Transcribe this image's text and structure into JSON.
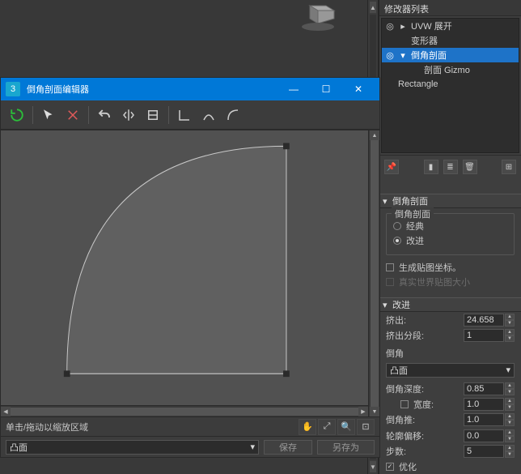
{
  "right": {
    "header": "修改器列表",
    "mods": {
      "uvw": "UVW 展开",
      "deform": "变形器",
      "bevel": "倒角剖面",
      "gizmo": "剖面 Gizmo",
      "rect": "Rectangle"
    },
    "rollout_bevel": "倒角剖面",
    "radio_classic": "经典",
    "radio_advance": "改进",
    "chk_gen_uvs": "生成贴图坐标。",
    "chk_realworld": "真实世界贴图大小",
    "rollout_advance": "改进",
    "extrude": {
      "label": "挤出:",
      "value": "24.658"
    },
    "extrude_segs": {
      "label": "挤出分段:",
      "value": "1"
    },
    "bevel_group": "倒角",
    "bevel_type": "凸面",
    "bevel_depth": {
      "label": "倒角深度:",
      "value": "0.85"
    },
    "width": {
      "label": "宽度:",
      "value": "1.0"
    },
    "bevel_push": {
      "label": "倒角推:",
      "value": "1.0"
    },
    "outline_offset": {
      "label": "轮廓偏移:",
      "value": "0.0"
    },
    "steps": {
      "label": "步数:",
      "value": "5"
    },
    "optimize": "优化"
  },
  "editor": {
    "title": "倒角剖面编辑器",
    "status": "单击/拖动以缩放区域",
    "dropdown": "凸面",
    "save": "保存",
    "save_as": "另存为"
  }
}
